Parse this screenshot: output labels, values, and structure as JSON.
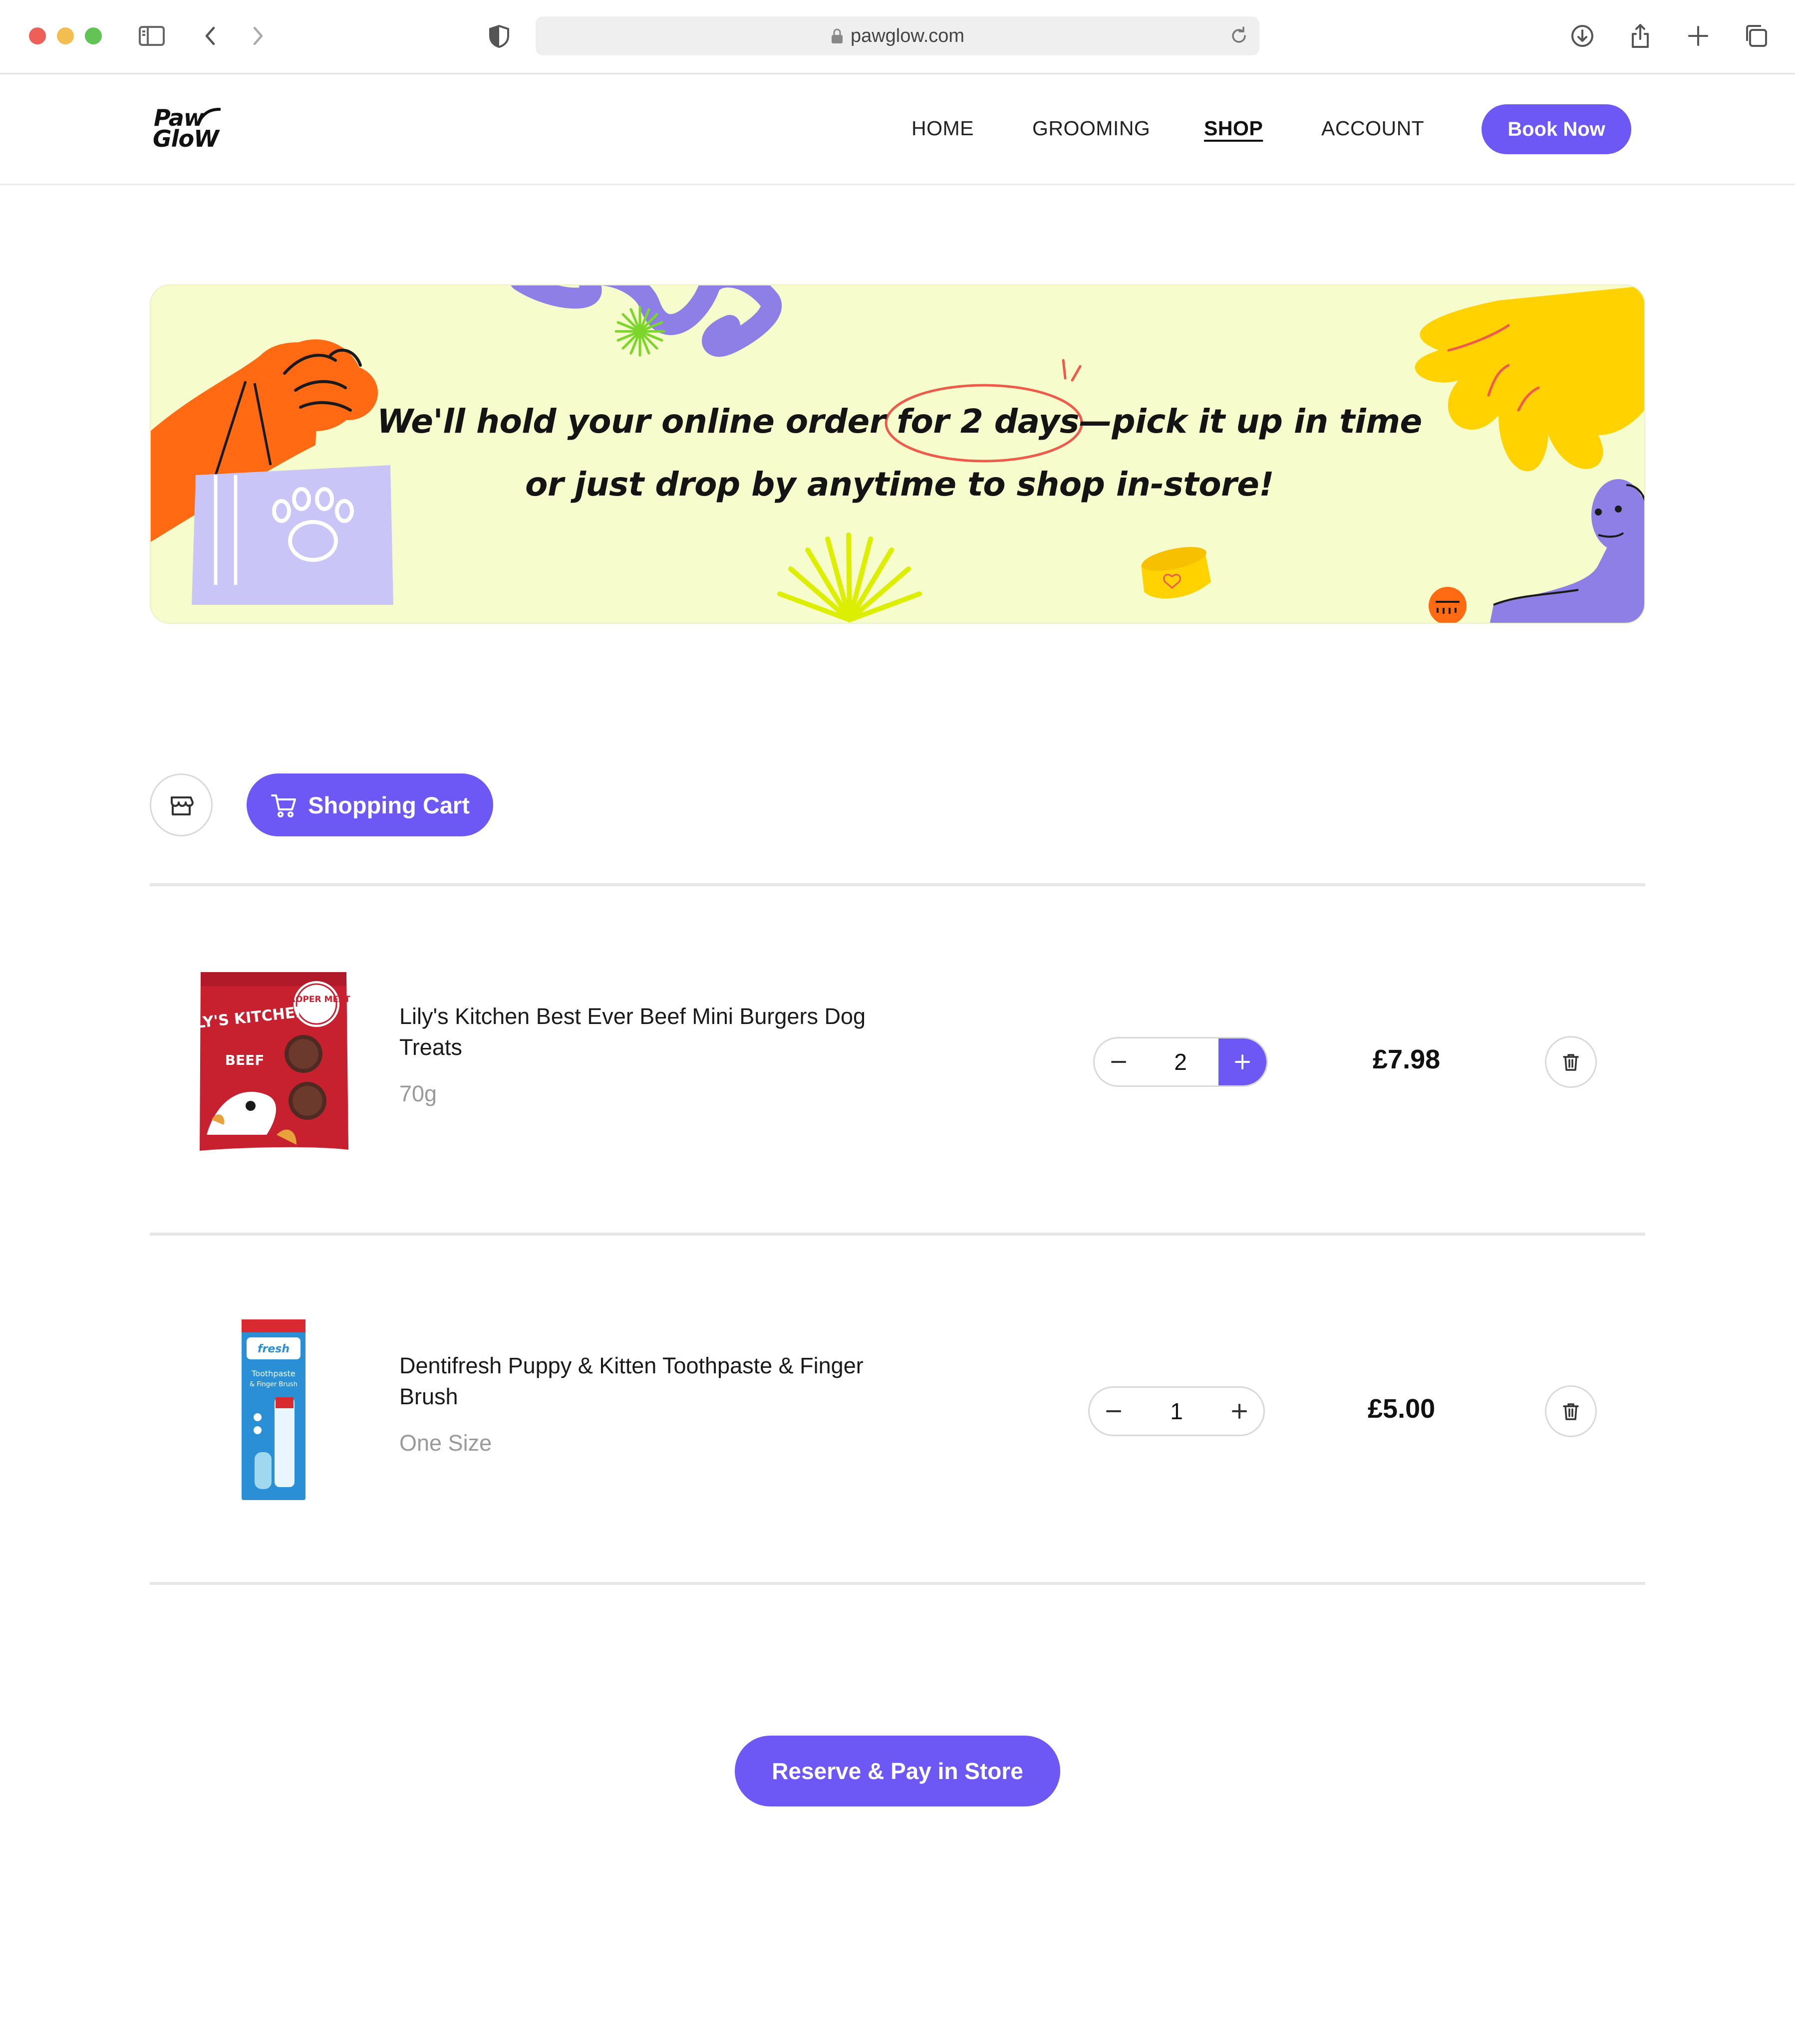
{
  "browser": {
    "url": "pawglow.com"
  },
  "header": {
    "logo_line1": "Paw",
    "logo_line2": "GloW",
    "nav": [
      {
        "label": "HOME"
      },
      {
        "label": "GROOMING"
      },
      {
        "label": "SHOP",
        "active": true
      },
      {
        "label": "ACCOUNT"
      }
    ],
    "book_label": "Book Now"
  },
  "banner": {
    "line1_a": "We'll hold your online order ",
    "line1_highlight": "for 2 days",
    "line1_b": "—pick it up in time",
    "line2": "or just drop by anytime to shop in-store!"
  },
  "cart": {
    "tab_label": "Shopping Cart",
    "items": [
      {
        "name": "Lily's Kitchen Best Ever Beef Mini Burgers Dog Treats",
        "variant": "70g",
        "quantity": "2",
        "price": "£7.98",
        "package_brand": "LILY'S KITCHEN",
        "package_badge": "PROPER MEAT",
        "package_product": "BEEF"
      },
      {
        "name": "Dentifresh Puppy & Kitten Toothpaste & Finger Brush",
        "variant": "One Size",
        "quantity": "1",
        "price": "£5.00",
        "package_brand": "fresh",
        "package_product": "Toothpaste & Finger Brush"
      }
    ],
    "reserve_label": "Reserve & Pay in Store"
  },
  "colors": {
    "accent": "#6d58f5",
    "banner_bg": "#f6fccb",
    "orange": "#ff6a13",
    "yellow": "#ffd200",
    "lavender": "#8e7fe6"
  }
}
